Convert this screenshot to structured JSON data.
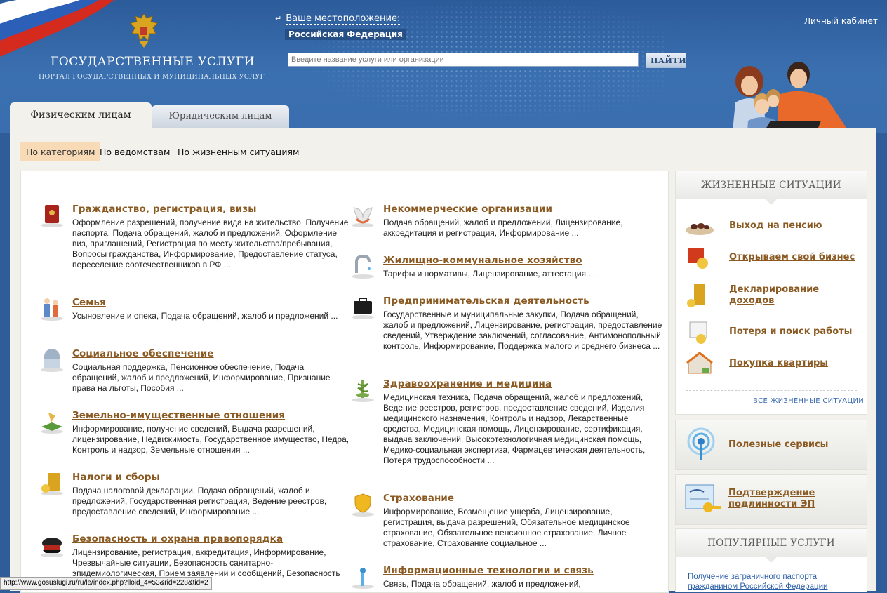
{
  "header": {
    "site_title": "ГОСУДАРСТВЕННЫЕ УСЛУГИ",
    "site_subtitle": "ПОРТАЛ ГОСУДАРСТВЕННЫХ И МУНИЦИПАЛЬНЫХ УСЛУГ",
    "location_label": "Ваше местоположение:",
    "location_value": "Российская Федерация",
    "search_placeholder": "Введите название услуги или организации",
    "search_button": "НАЙТИ",
    "cabinet_link": "Личный кабинет"
  },
  "tabs": [
    {
      "label": "Физическим лицам",
      "active": true
    },
    {
      "label": "Юридическим лицам",
      "active": false
    }
  ],
  "filters": [
    {
      "label": "По категориям",
      "active": true
    },
    {
      "label": "По ведомствам",
      "active": false
    },
    {
      "label": "По жизненным ситуациям",
      "active": false
    }
  ],
  "categories_left": [
    {
      "icon": "passport-icon",
      "title": "Гражданство, регистрация, визы",
      "description": "Оформление разрешений, получение вида на жительство, Получение паспорта, Подача обращений, жалоб и предложений, Оформление виз, приглашений, Регистрация по месту жительства/пребывания, Вопросы гражданства, Информирование, Предоставление статуса, переселение соотечественников в РФ ..."
    },
    {
      "icon": "family-icon",
      "title": "Семья",
      "description": "Усыновление и опека, Подача обращений, жалоб и предложений ..."
    },
    {
      "icon": "social-security-icon",
      "title": "Социальное обеспечение",
      "description": "Социальная поддержка, Пенсионное обеспечение, Подача обращений, жалоб и предложений, Информирование, Признание права на льготы, Пособия ..."
    },
    {
      "icon": "land-property-icon",
      "title": "Земельно-имущественные отношения",
      "description": "Информирование, получение сведений, Выдача разрешений, лицензирование, Недвижимость, Государственное имущество, Недра, Контроль и надзор, Земельные отношения ..."
    },
    {
      "icon": "taxes-icon",
      "title": "Налоги и сборы",
      "description": "Подача налоговой декларации, Подача обращений, жалоб и предложений, Государственная регистрация, Ведение реестров, предоставление сведений, Информирование ..."
    },
    {
      "icon": "police-cap-icon",
      "title": "Безопасность и охрана правопорядка",
      "description": "Лицензирование, регистрация, аккредитация, Информирование, Чрезвычайные ситуации, Безопасность санитарно-эпидемиологическая, Прием заявлений и сообщений, Безопасность радиационная,"
    }
  ],
  "categories_right": [
    {
      "icon": "dove-icon",
      "title": "Некоммерческие организации",
      "description": "Подача обращений, жалоб и предложений, Лицензирование, аккредитация и регистрация, Информирование ..."
    },
    {
      "icon": "faucet-icon",
      "title": "Жилищно-коммунальное хозяйство",
      "description": "Тарифы и нормативы, Лицензирование, аттестация ..."
    },
    {
      "icon": "briefcase-icon",
      "title": "Предпринимательская деятельность",
      "description": "Государственные и муниципальные закупки, Подача обращений, жалоб и предложений, Лицензирование, регистрация, предоставление сведений, Утверждение заключений, согласование, Антимонопольный контроль, Информирование, Поддержка малого и среднего бизнеса ..."
    },
    {
      "icon": "medicine-icon",
      "title": "Здравоохранение и медицина",
      "description": "Медицинская техника, Подача обращений, жалоб и предложений, Ведение реестров, регистров, предоставление сведений, Изделия медицинского назначения, Контроль и надзор, Лекарственные средства, Медицинская помощь, Лицензирование, сертификация, выдача заключений, Высокотехнологичная медицинская помощь, Медико-социальная экспертиза, Фармацевтическая деятельность, Потеря трудоспособности ..."
    },
    {
      "icon": "shield-icon",
      "title": "Страхование",
      "description": "Информирование, Возмещение ущерба, Лицензирование, регистрация, выдача разрешений, Обязательное медицинское страхование, Обязательное пенсионное страхование, Личное страхование, Страхование социальное ..."
    },
    {
      "icon": "antenna-icon",
      "title": "Информационные технологии и связь",
      "description": "Связь, Подача обращений, жалоб и предложений,"
    }
  ],
  "sidebar": {
    "life_title": "ЖИЗНЕННЫЕ СИТУАЦИИ",
    "life_items": [
      {
        "icon": "pension-icon",
        "label": "Выход на пенсию"
      },
      {
        "icon": "business-icon",
        "label": "Открываем свой бизнес"
      },
      {
        "icon": "declaration-icon",
        "label": "Декларирование доходов"
      },
      {
        "icon": "job-search-icon",
        "label": "Потеря и поиск работы"
      },
      {
        "icon": "house-icon",
        "label": "Покупка квартиры"
      }
    ],
    "all_life_link": "ВСЕ ЖИЗНЕННЫЕ СИТУАЦИИ",
    "useful_services": "Полезные сервисы",
    "signature_check": "Подтверждение подлинности ЭП",
    "popular_title": "ПОПУЛЯРНЫЕ УСЛУГИ",
    "popular_link": "Получение заграничного паспорта гражданином Российской Федерации"
  },
  "status_bar": "http://www.gosuslugi.ru/ru/le/index.php?lloid_4=53&rid=228&tid=2"
}
